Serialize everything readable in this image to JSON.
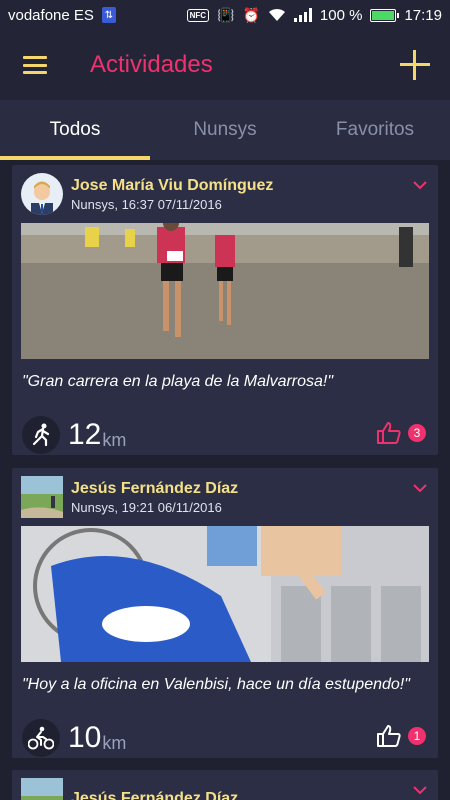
{
  "status_bar": {
    "carrier": "vodafone ES",
    "nfc": "NFC",
    "battery_pct": "100 %",
    "battery_level": 1.0,
    "time": "17:19"
  },
  "appbar": {
    "title": "Actividades"
  },
  "tabs": [
    {
      "label": "Todos",
      "active": true
    },
    {
      "label": "Nunsys",
      "active": false
    },
    {
      "label": "Favoritos",
      "active": false
    }
  ],
  "posts": [
    {
      "author": "Jose María Viu Domínguez",
      "meta": "Nunsys, 16:37 07/11/2016",
      "caption": "\"Gran carrera en la playa de la Malvarrosa!\"",
      "activity": "running-icon",
      "distance": "12",
      "unit": "km",
      "likes": "3",
      "liked": true
    },
    {
      "author": "Jesús Fernández Díaz",
      "meta": "Nunsys, 19:21 06/11/2016",
      "caption": "\"Hoy a la oficina en Valenbisi, hace un día estupendo!\"",
      "activity": "cycling-icon",
      "distance": "10",
      "unit": "km",
      "likes": "1",
      "liked": false
    },
    {
      "author": "Jesús Fernández Díaz"
    }
  ],
  "colors": {
    "accent": "#f0316e",
    "yellow": "#f5d66b",
    "card": "#2b2e44",
    "bg": "#1f2131"
  }
}
